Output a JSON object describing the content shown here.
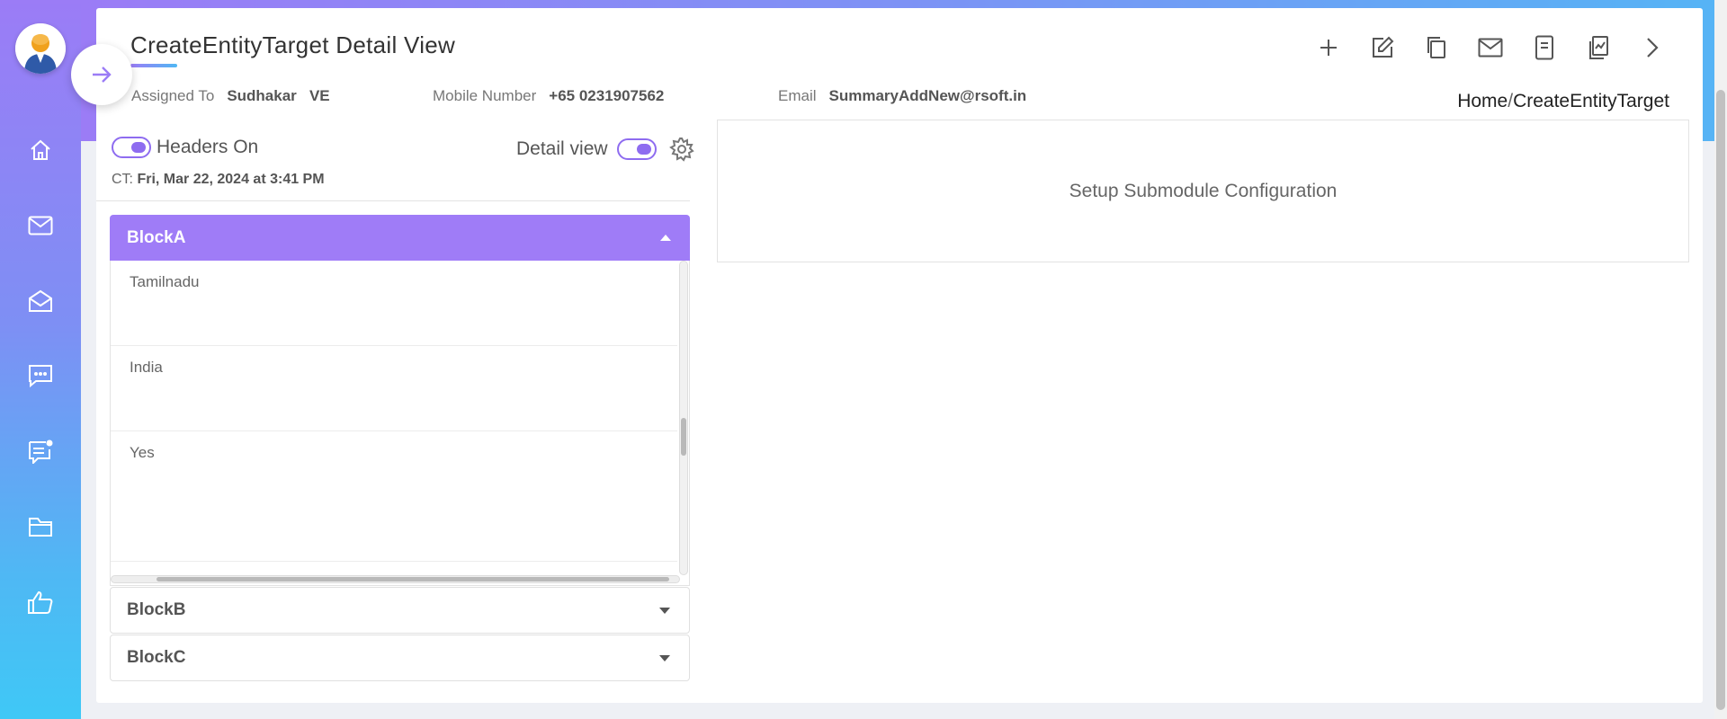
{
  "header": {
    "title": "CreateEntityTarget Detail View",
    "breadcrumb": {
      "home": "Home",
      "separator": "/",
      "current": "CreateEntityTarget"
    }
  },
  "meta": {
    "assigned_to_label": "Assigned To",
    "assigned_to_value": "Sudhakar   VE",
    "mobile_label": "Mobile Number",
    "mobile_value": "+65 0231907562",
    "email_label": "Email",
    "email_value": "SummaryAddNew@rsoft.in"
  },
  "toolbar": {
    "icons": [
      "plus-icon",
      "edit-icon",
      "copy-icon",
      "mail-icon",
      "mobile-icon",
      "report-icon",
      "chevron-right-icon"
    ]
  },
  "sidebar": {
    "items": [
      "home-icon",
      "mail-icon",
      "mail-open-icon",
      "chat-icon",
      "feedback-icon",
      "folder-icon",
      "thumbs-up-icon"
    ]
  },
  "panel": {
    "headers_on_label": "Headers On",
    "detail_view_label": "Detail view",
    "ct_label": "CT:",
    "ct_value": "Fri, Mar 22, 2024 at 3:41 PM"
  },
  "blocks": {
    "block_a": {
      "label": "BlockA",
      "fields": [
        "Tamilnadu",
        "India",
        "Yes"
      ]
    },
    "block_b": {
      "label": "BlockB"
    },
    "block_c": {
      "label": "BlockC"
    }
  },
  "submodule": {
    "text": "Setup Submodule Configuration"
  },
  "colors": {
    "accent_purple": "#9f7cf7",
    "accent_blue": "#4fb8f4"
  }
}
